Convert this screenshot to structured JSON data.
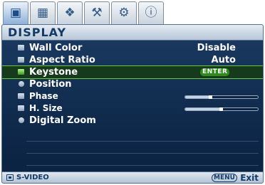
{
  "tabs": [
    {
      "icon": "display-icon",
      "glyph": "▣",
      "active": true
    },
    {
      "icon": "picture-icon",
      "glyph": "▦",
      "active": false
    },
    {
      "icon": "source-icon",
      "glyph": "❖",
      "active": false
    },
    {
      "icon": "settings-icon",
      "glyph": "⚒",
      "active": false
    },
    {
      "icon": "advanced-settings-icon",
      "glyph": "⚙",
      "active": false
    },
    {
      "icon": "information-icon",
      "glyph": "ⓘ",
      "active": false
    }
  ],
  "menu": {
    "title": "DISPLAY",
    "items": [
      {
        "label": "Wall Color",
        "value": "Disable",
        "icon": "wall-color-icon"
      },
      {
        "label": "Aspect Ratio",
        "value": "Auto",
        "icon": "aspect-ratio-icon"
      },
      {
        "label": "Keystone",
        "action": "ENTER",
        "icon": "keystone-icon",
        "selected": true
      },
      {
        "label": "Position",
        "icon": "position-icon"
      },
      {
        "label": "Phase",
        "slider_level": 0.35,
        "icon": "phase-icon"
      },
      {
        "label": "H. Size",
        "slider_level": 0.5,
        "icon": "h-size-icon"
      },
      {
        "label": "Digital Zoom",
        "icon": "digital-zoom-icon"
      }
    ]
  },
  "footer": {
    "source_icon": "input-source-icon",
    "source": "S-VIDEO",
    "menu_key": "MENU",
    "exit": "Exit"
  },
  "colors": {
    "panel": "#102b4d",
    "highlight": "#6acb3a",
    "title": "#143a66"
  }
}
